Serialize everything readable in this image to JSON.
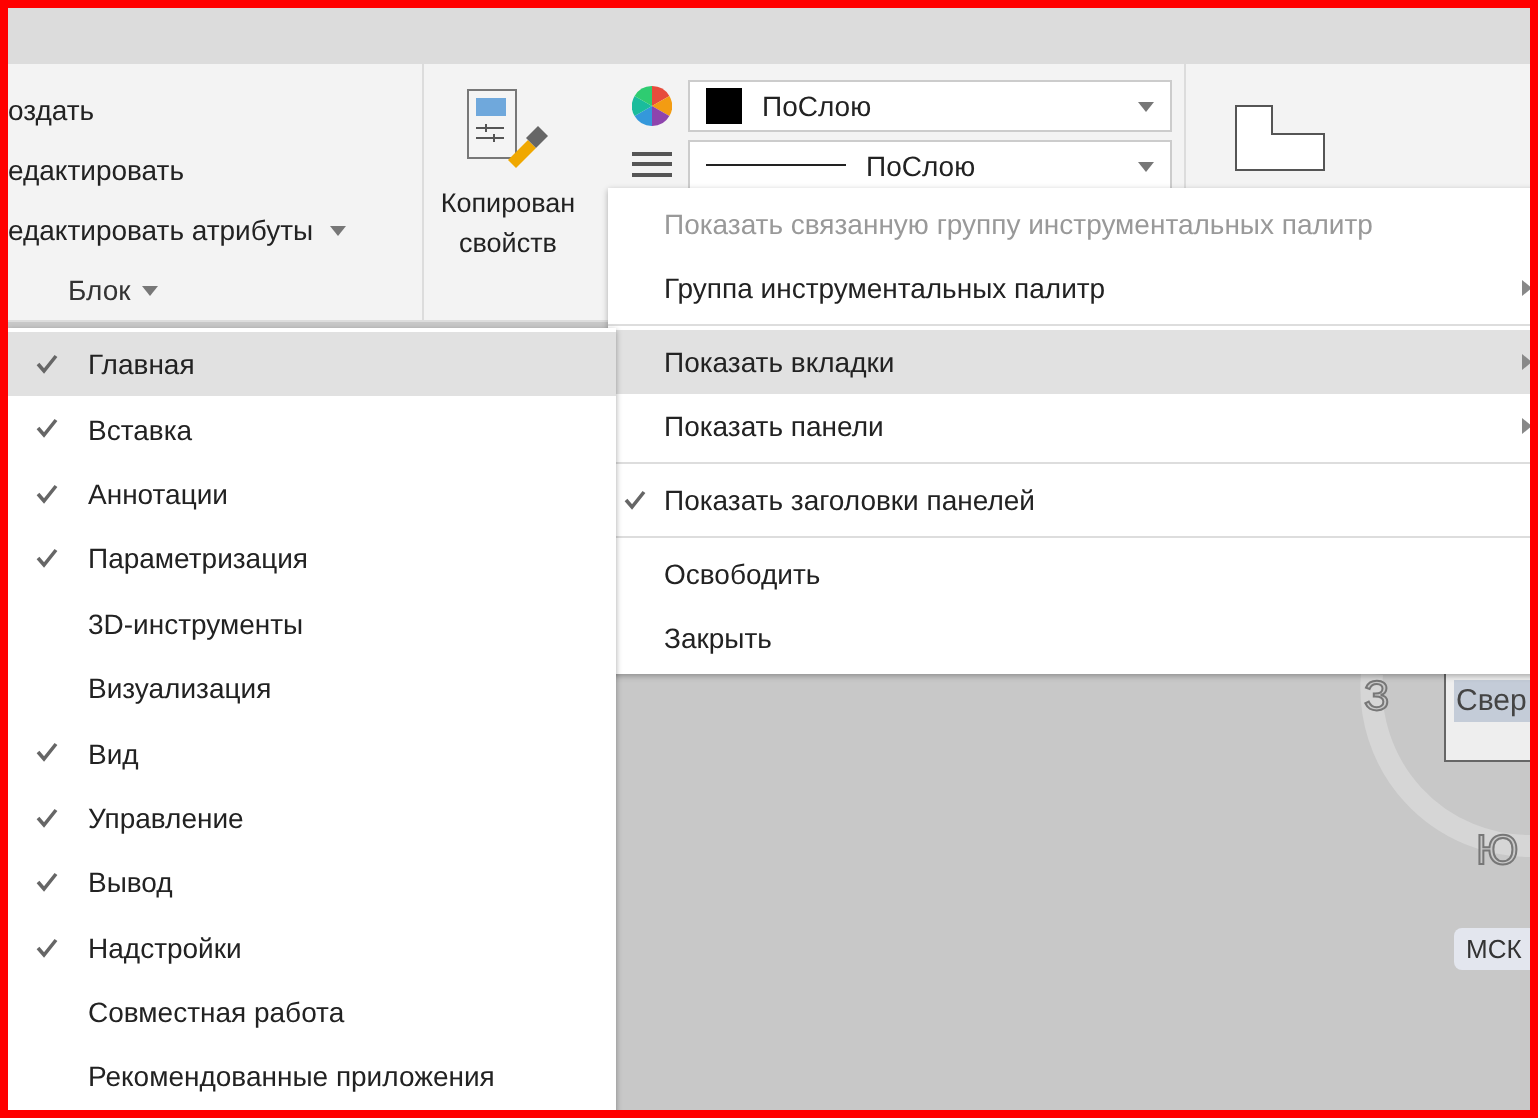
{
  "ribbon": {
    "block_panel": {
      "items": [
        {
          "label": "оздать",
          "dropdown": false
        },
        {
          "label": "едактировать",
          "dropdown": false
        },
        {
          "label": "едактировать атрибуты",
          "dropdown": true
        }
      ],
      "title": "Блок"
    },
    "copy_properties": {
      "label_lines": [
        "Копирован",
        "свойств"
      ]
    },
    "properties": {
      "color_setting": "ПоСлою",
      "linetype_setting": "ПоСлою"
    }
  },
  "context_menu": {
    "groups": [
      [
        {
          "label": "Показать связанную группу инструментальных палитр",
          "disabled": true,
          "submenu": false,
          "checked": false,
          "selected": false
        },
        {
          "label": "Группа инструментальных палитр",
          "disabled": false,
          "submenu": true,
          "checked": false,
          "selected": false
        }
      ],
      [
        {
          "label": "Показать вкладки",
          "disabled": false,
          "submenu": true,
          "checked": false,
          "selected": true
        },
        {
          "label": "Показать панели",
          "disabled": false,
          "submenu": true,
          "checked": false,
          "selected": false
        }
      ],
      [
        {
          "label": "Показать заголовки панелей",
          "disabled": false,
          "submenu": false,
          "checked": true,
          "selected": false
        }
      ],
      [
        {
          "label": "Освободить",
          "disabled": false,
          "submenu": false,
          "checked": false,
          "selected": false
        },
        {
          "label": "Закрыть",
          "disabled": false,
          "submenu": false,
          "checked": false,
          "selected": false
        }
      ]
    ]
  },
  "tabs_submenu": [
    {
      "label": "Главная",
      "checked": true,
      "selected": true
    },
    {
      "label": "Вставка",
      "checked": true,
      "selected": false
    },
    {
      "label": "Аннотации",
      "checked": true,
      "selected": false
    },
    {
      "label": "Параметризация",
      "checked": true,
      "selected": false
    },
    {
      "label": "3D-инструменты",
      "checked": false,
      "selected": false
    },
    {
      "label": "Визуализация",
      "checked": false,
      "selected": false
    },
    {
      "label": "Вид",
      "checked": true,
      "selected": false
    },
    {
      "label": "Управление",
      "checked": true,
      "selected": false
    },
    {
      "label": "Вывод",
      "checked": true,
      "selected": false
    },
    {
      "label": "Надстройки",
      "checked": true,
      "selected": false
    },
    {
      "label": "Совместная работа",
      "checked": false,
      "selected": false
    },
    {
      "label": "Рекомендованные приложения",
      "checked": false,
      "selected": false
    }
  ],
  "viewcube": {
    "west": "З",
    "top": "Свер",
    "south": "Ю",
    "ucs": "МСК"
  }
}
